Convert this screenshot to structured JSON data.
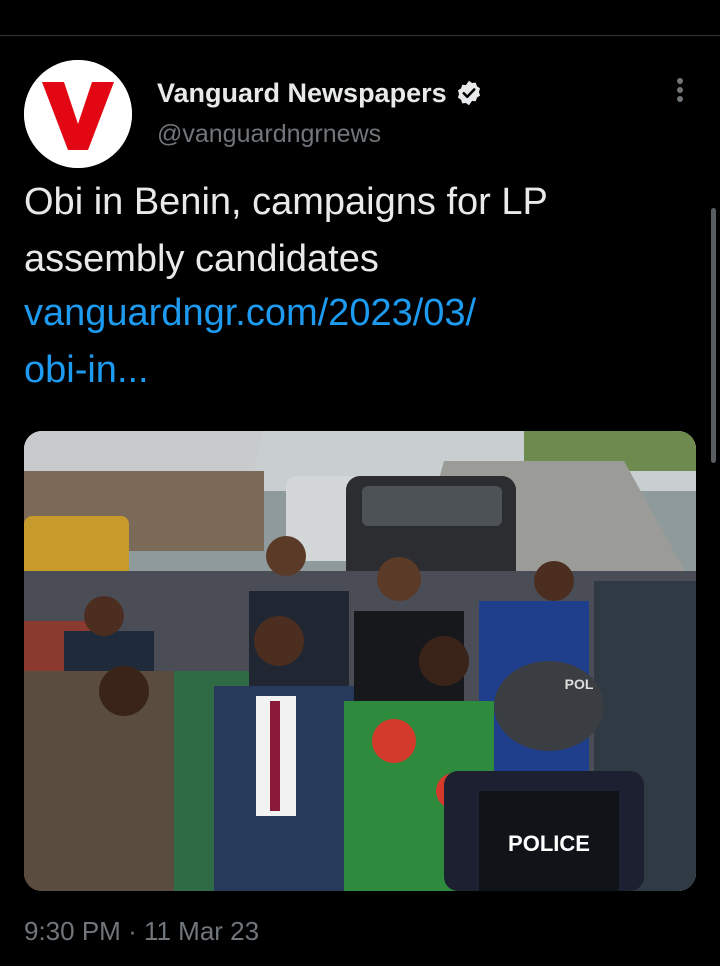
{
  "tweet": {
    "author": {
      "display_name": "Vanguard Newspapers",
      "handle": "@vanguardngrnews",
      "verified": true,
      "avatar_letter": "V",
      "avatar_color": "#e30613"
    },
    "text_line1": "Obi in Benin, campaigns for LP",
    "text_line2": "assembly candidates",
    "link_line1": "vanguardngr.com/2023/03/",
    "link_line2": "obi-in...",
    "link_color": "#1d9bf0",
    "media": {
      "vest_text": "POLICE",
      "helmet_text": "POL"
    },
    "time": "9:30 PM",
    "separator": "·",
    "date": "11 Mar 23"
  },
  "icons": {
    "verified": "verified-badge-icon",
    "more": "more-options-icon"
  }
}
